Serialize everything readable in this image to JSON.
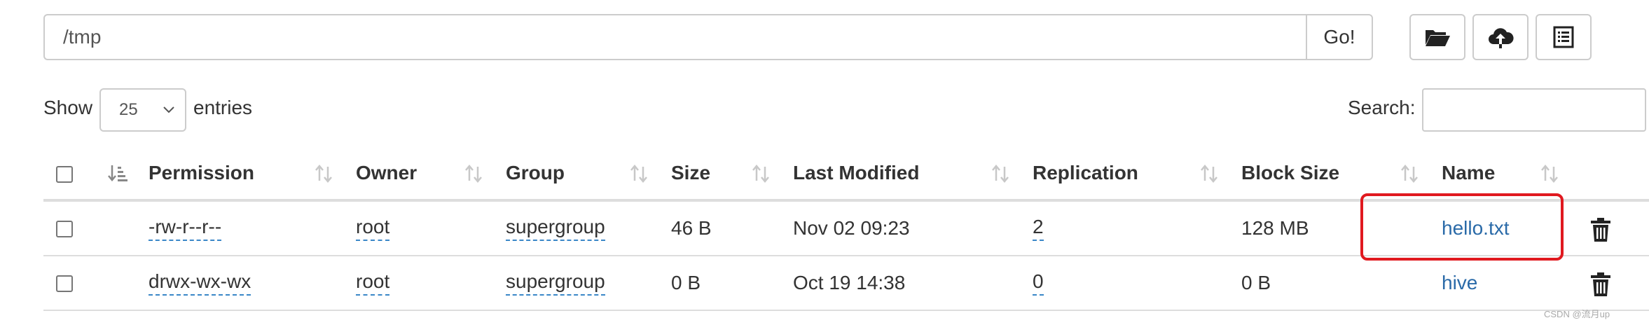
{
  "path_bar": {
    "value": "/tmp",
    "go_label": "Go!"
  },
  "toolbar": [
    "folder-open-icon",
    "upload-cloud-icon",
    "list-icon"
  ],
  "length": {
    "show_label": "Show",
    "selected": "25",
    "entries_label": "entries"
  },
  "search": {
    "label": "Search:",
    "value": ""
  },
  "table": {
    "headers": [
      "Permission",
      "Owner",
      "Group",
      "Size",
      "Last Modified",
      "Replication",
      "Block Size",
      "Name"
    ],
    "rows": [
      {
        "permission": "-rw-r--r--",
        "owner": "root",
        "group": "supergroup",
        "size": "46 B",
        "last_modified": "Nov 02 09:23",
        "replication": "2",
        "block_size": "128 MB",
        "name": "hello.txt"
      },
      {
        "permission": "drwx-wx-wx",
        "owner": "root",
        "group": "supergroup",
        "size": "0 B",
        "last_modified": "Oct 19 14:38",
        "replication": "0",
        "block_size": "0 B",
        "name": "hive"
      }
    ]
  },
  "watermark": "CSDN @流月up",
  "colors": {
    "link": "#2a6aa8",
    "highlight": "#e0191f",
    "border": "#cccccc"
  }
}
